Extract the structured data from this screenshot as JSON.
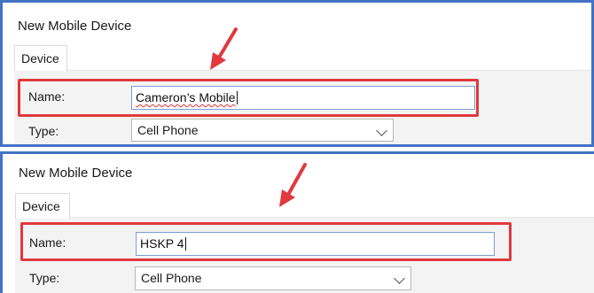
{
  "panels": [
    {
      "title": "New Mobile Device",
      "tab": "Device",
      "name_label": "Name:",
      "name_value": "Cameron’s Mobile",
      "type_label": "Type:",
      "type_value": "Cell Phone"
    },
    {
      "title": "New Mobile Device",
      "tab": "Device",
      "name_label": "Name:",
      "name_value": "HSKP 4",
      "type_label": "Type:",
      "type_value": "Cell Phone"
    }
  ],
  "colors": {
    "panel_border": "#4472c4",
    "highlight": "#e0393e",
    "arrow": "#e0393e"
  },
  "icons": [
    "arrow-annotation-icon",
    "chevron-down-icon"
  ]
}
